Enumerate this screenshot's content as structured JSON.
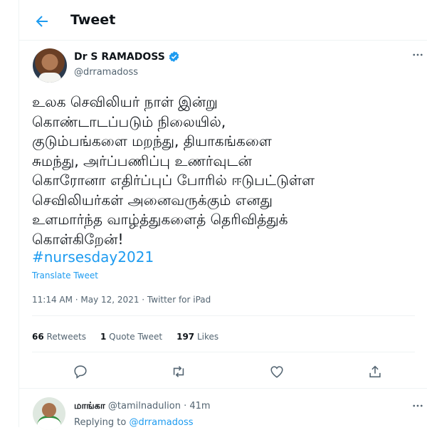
{
  "header": {
    "title": "Tweet"
  },
  "tweet": {
    "author_name": "Dr S RAMADOSS",
    "handle": "@drramadoss",
    "text_lines": [
      "உலக செவிலியர் நாள் இன்று",
      "கொண்டாடப்படும் நிலையில்,",
      "குடும்பங்களை மறந்து, தியாகங்களை",
      "சுமந்து, அர்ப்பணிப்பு உணர்வுடன்",
      "கொரோனா எதிர்ப்புப் போரில் ஈடுபட்டுள்ள",
      "செவிலியர்கள் அனைவருக்கும் எனது",
      "உளமார்ந்த வாழ்த்துகளைத் தெரிவித்துக்",
      "கொள்கிறேன்!"
    ],
    "hashtag": "#nursesday2021",
    "translate_label": "Translate Tweet",
    "meta": "11:14 AM · May 12, 2021 · Twitter for iPad",
    "stats": {
      "retweets_count": "66",
      "retweets_label": "Retweets",
      "quotes_count": "1",
      "quotes_label": "Quote Tweet",
      "likes_count": "197",
      "likes_label": "Likes"
    }
  },
  "reply": {
    "name": "மாங்கா",
    "handle_time": "@tamilnadulion · 41m",
    "replying_prefix": "Replying to ",
    "replying_handle": "@drramadoss"
  },
  "icons": {
    "back": "arrow-left-icon",
    "verified": "verified-badge-icon",
    "more": "more-horizontal-icon",
    "reply": "reply-icon",
    "retweet": "retweet-icon",
    "like": "heart-icon",
    "share": "share-icon"
  },
  "colors": {
    "accent": "#1d9bf0",
    "text": "#0f1419",
    "muted": "#536471"
  }
}
